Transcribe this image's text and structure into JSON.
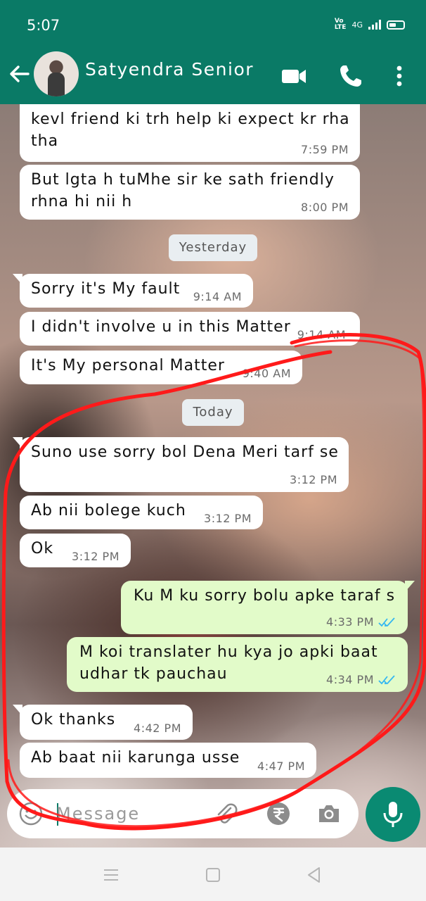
{
  "status_bar": {
    "time": "5:07",
    "volte": "Vo\nLTE",
    "network": "4G"
  },
  "header": {
    "contact_name": "Satyendra Senior"
  },
  "messages": [
    {
      "text": "kevl friend ki trh help ki expect kr rha\ntha",
      "time": "7:59 PM",
      "dir": "in"
    },
    {
      "text": "But lgta h tuMhe sir ke sath friendly\nrhna hi nii h",
      "time": "8:00 PM",
      "dir": "in"
    },
    {
      "text": "Sorry it's My fault",
      "time": "9:14 AM",
      "dir": "in"
    },
    {
      "text": "I didn't involve u in this Matter",
      "time": "9:14 AM",
      "dir": "in"
    },
    {
      "text": "It's My personal Matter",
      "time": "9:40 AM",
      "dir": "in"
    },
    {
      "text": "Suno use sorry bol Dena Meri tarf se",
      "time": "3:12 PM",
      "dir": "in"
    },
    {
      "text": "Ab nii bolege kuch",
      "time": "3:12 PM",
      "dir": "in"
    },
    {
      "text": "Ok",
      "time": "3:12 PM",
      "dir": "in"
    },
    {
      "text": "Ku M ku sorry bolu apke taraf s",
      "time": "4:33 PM",
      "dir": "out",
      "status": "read"
    },
    {
      "text": "M koi translater hu kya jo apki baat\nudhar tk pauchau",
      "time": "4:34 PM",
      "dir": "out",
      "status": "read"
    },
    {
      "text": "Ok thanks",
      "time": "4:42 PM",
      "dir": "in"
    },
    {
      "text": "Ab baat nii karunga usse",
      "time": "4:47 PM",
      "dir": "in"
    }
  ],
  "date_separators": {
    "yesterday": "Yesterday",
    "today": "Today"
  },
  "composer": {
    "placeholder": "Message"
  },
  "icons": {
    "back": "arrow-back-icon",
    "video": "video-call-icon",
    "call": "phone-icon",
    "menu": "more-vert-icon",
    "emoji": "emoji-icon",
    "attach": "paperclip-icon",
    "payment": "rupee-icon",
    "camera": "camera-icon",
    "mic": "mic-icon"
  },
  "colors": {
    "header": "#0a7a66",
    "incoming": "#ffffff",
    "outgoing": "#e2fbc9",
    "read_ticks": "#34b7f1",
    "annotation": "#ff1a1a",
    "mic_button": "#0a8a72"
  }
}
